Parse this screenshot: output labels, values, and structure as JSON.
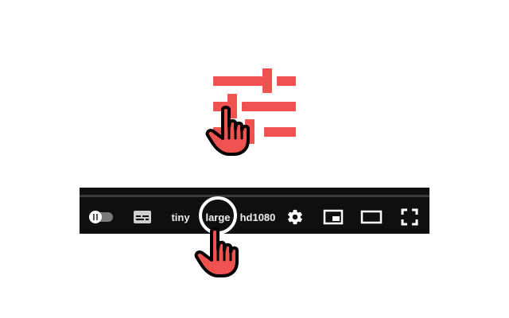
{
  "colors": {
    "accent": "#f0524f",
    "bar_background": "#0f0f0f",
    "control_text": "#eeeeee"
  },
  "hero_icon": "tune-sliders-icon",
  "cursor_icon": "pointing-hand-icon",
  "player_controls": {
    "autoplay_toggle_icon": "autoplay-toggle-icon",
    "subtitles_icon": "subtitles-icon",
    "quality_options": [
      "tiny",
      "large",
      "hd1080"
    ],
    "highlighted_quality": "large",
    "settings_icon": "gear-icon",
    "miniplayer_icon": "miniplayer-icon",
    "theater_icon": "theater-mode-icon",
    "fullscreen_icon": "fullscreen-icon"
  }
}
